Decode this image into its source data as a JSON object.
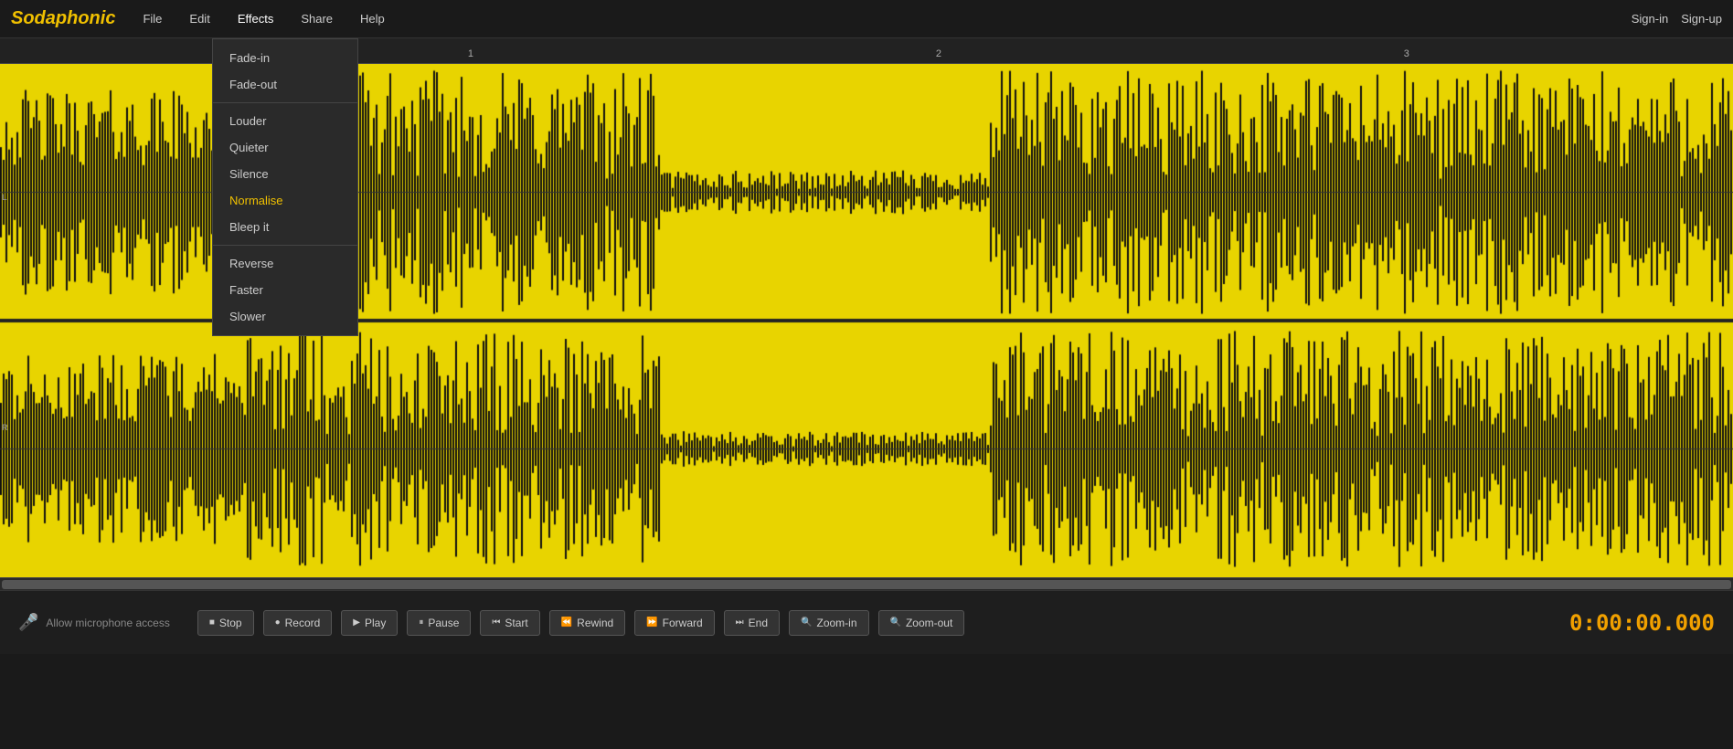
{
  "app": {
    "logo": "Sodaphonic",
    "nav": {
      "items": [
        {
          "label": "File",
          "id": "file"
        },
        {
          "label": "Edit",
          "id": "edit"
        },
        {
          "label": "Effects",
          "id": "effects"
        },
        {
          "label": "Share",
          "id": "share"
        },
        {
          "label": "Help",
          "id": "help"
        }
      ],
      "auth": [
        {
          "label": "Sign-in",
          "id": "signin"
        },
        {
          "label": "Sign-up",
          "id": "signup"
        }
      ]
    }
  },
  "effects_menu": {
    "items": [
      {
        "label": "Fade-in",
        "id": "fade-in",
        "highlighted": false
      },
      {
        "label": "Fade-out",
        "id": "fade-out",
        "highlighted": false
      },
      {
        "label": "Louder",
        "id": "louder",
        "highlighted": false
      },
      {
        "label": "Quieter",
        "id": "quieter",
        "highlighted": false
      },
      {
        "label": "Silence",
        "id": "silence",
        "highlighted": false
      },
      {
        "label": "Normalise",
        "id": "normalise",
        "highlighted": true
      },
      {
        "label": "Bleep it",
        "id": "bleep-it",
        "highlighted": false
      },
      {
        "label": "Reverse",
        "id": "reverse",
        "highlighted": false
      },
      {
        "label": "Faster",
        "id": "faster",
        "highlighted": false
      },
      {
        "label": "Slower",
        "id": "slower",
        "highlighted": false
      }
    ]
  },
  "ruler": {
    "marks": [
      {
        "label": "1",
        "position": "27%"
      },
      {
        "label": "2",
        "position": "54%"
      },
      {
        "label": "3",
        "position": "81%"
      }
    ]
  },
  "tracks": [
    {
      "label": "L",
      "top": "30%"
    },
    {
      "label": "R",
      "top": "70%"
    }
  ],
  "toolbar": {
    "mic_label": "Allow microphone access",
    "buttons": [
      {
        "label": "Stop",
        "id": "stop",
        "icon": "■"
      },
      {
        "label": "Record",
        "id": "record",
        "icon": "●"
      },
      {
        "label": "Play",
        "id": "play",
        "icon": "▶"
      },
      {
        "label": "Pause",
        "id": "pause",
        "icon": "⏸"
      },
      {
        "label": "Start",
        "id": "start",
        "icon": "⏮"
      },
      {
        "label": "Rewind",
        "id": "rewind",
        "icon": "⏪"
      },
      {
        "label": "Forward",
        "id": "forward",
        "icon": "⏩"
      },
      {
        "label": "End",
        "id": "end",
        "icon": "⏭"
      },
      {
        "label": "Zoom-in",
        "id": "zoom-in",
        "icon": "🔍"
      },
      {
        "label": "Zoom-out",
        "id": "zoom-out",
        "icon": "🔍"
      }
    ],
    "time": "0:00:00.000"
  },
  "waveform": {
    "background": "#f0e000",
    "foreground": "#111111"
  }
}
